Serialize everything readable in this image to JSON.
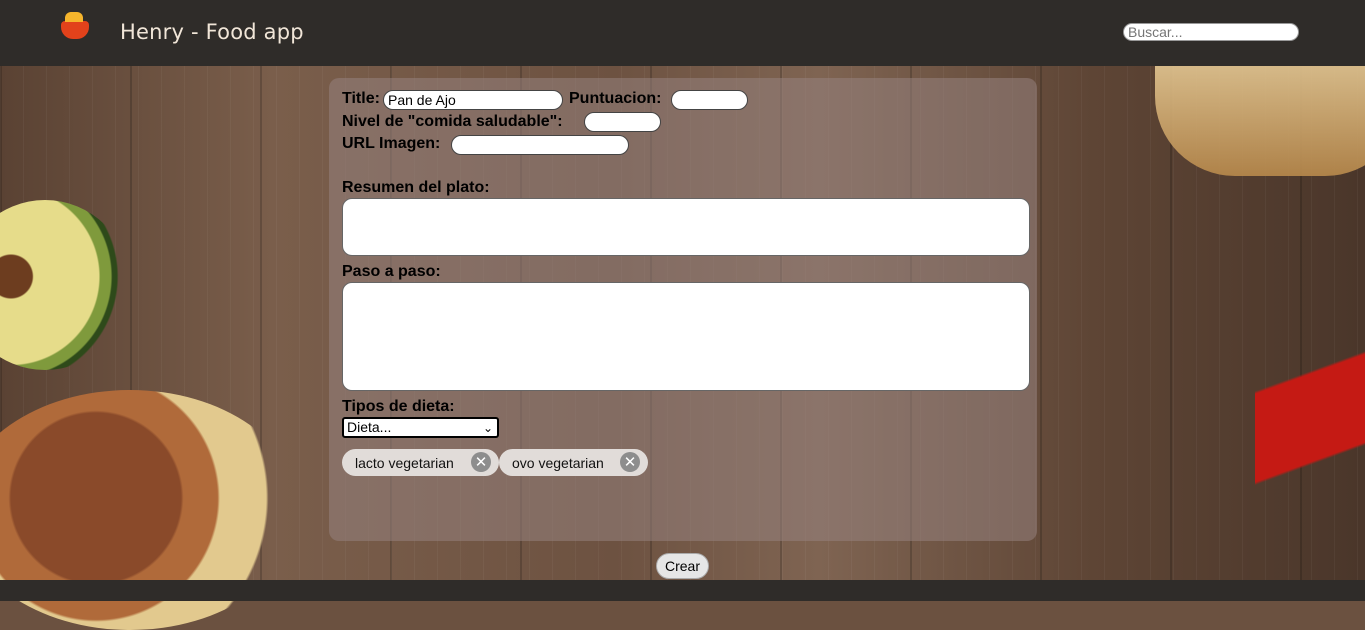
{
  "header": {
    "app_title": "Henry - Food app",
    "search_placeholder": "Buscar..."
  },
  "form": {
    "title_label": "Title:",
    "title_value": "Pan de Ajo",
    "puntuacion_label": "Puntuacion:",
    "puntuacion_value": "",
    "nivel_label": "Nivel de \"comida saludable\":",
    "nivel_value": "",
    "url_label": "URL Imagen:",
    "url_value": "",
    "resumen_label": "Resumen del plato:",
    "resumen_value": "",
    "paso_label": "Paso a paso:",
    "paso_value": "",
    "dieta_label": "Tipos de dieta:",
    "dieta_select": "Dieta...",
    "selected_diets": [
      "lacto vegetarian",
      "ovo vegetarian"
    ],
    "submit_label": "Crear"
  },
  "icons": {
    "logo": "food-bowl-icon",
    "remove": "close-circle-icon",
    "dropdown": "chevron-down-icon"
  },
  "colors": {
    "header_bg": "#2f2c29",
    "title_text": "#f1e6d8",
    "panel_bg": "#96827d"
  }
}
